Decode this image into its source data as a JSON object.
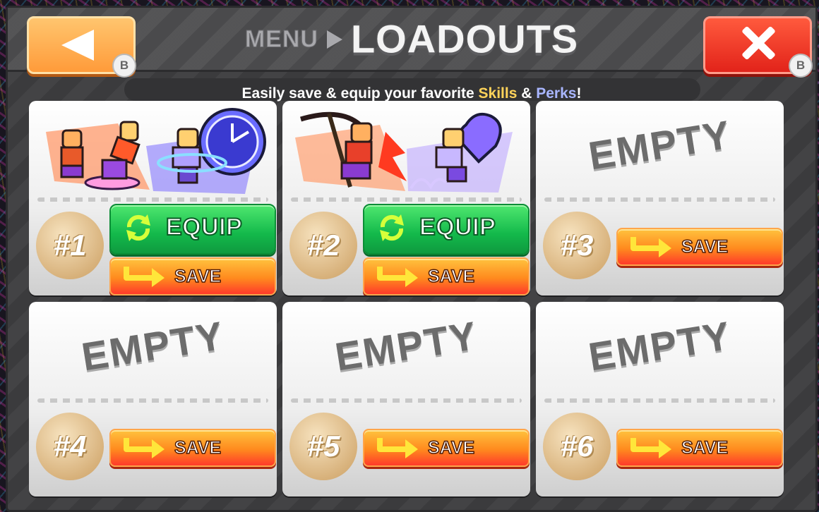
{
  "header": {
    "breadcrumb": "MENU",
    "title": "LOADOUTS",
    "back_badge": "B",
    "close_badge": "B"
  },
  "subtitle": {
    "prefix": "Easily save & equip your favorite ",
    "skills": "Skills",
    "middle": " & ",
    "perks": "Perks",
    "suffix": "!"
  },
  "slots": [
    {
      "number": "#1",
      "state": "filled",
      "equip_label": "EQUIP",
      "save_label": "SAVE",
      "skill_icons": [
        "punch-skill-icon",
        "time-dash-skill-icon"
      ]
    },
    {
      "number": "#2",
      "state": "filled",
      "equip_label": "EQUIP",
      "save_label": "SAVE",
      "skill_icons": [
        "scythe-skill-icon",
        "heart-dash-skill-icon"
      ]
    },
    {
      "number": "#3",
      "state": "empty",
      "empty_label": "EMPTY",
      "save_label": "SAVE"
    },
    {
      "number": "#4",
      "state": "empty",
      "empty_label": "EMPTY",
      "save_label": "SAVE"
    },
    {
      "number": "#5",
      "state": "empty",
      "empty_label": "EMPTY",
      "save_label": "SAVE"
    },
    {
      "number": "#6",
      "state": "empty",
      "empty_label": "EMPTY",
      "save_label": "SAVE"
    }
  ],
  "colors": {
    "equip_green": "#13b94b",
    "save_orange": "#ff8a1e",
    "close_red": "#e2231a",
    "back_orange": "#ff9b3a",
    "skills_highlight": "#ffd35a",
    "perks_highlight": "#a9b6ff"
  }
}
